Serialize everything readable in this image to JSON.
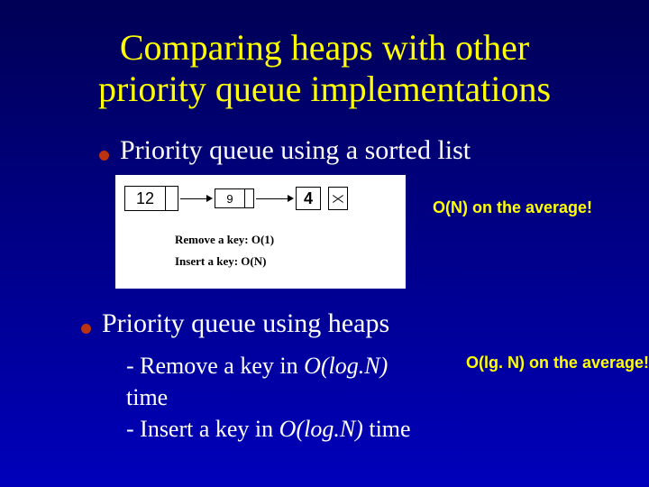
{
  "title_line1": "Comparing heaps with other",
  "title_line2": "priority queue implementations",
  "bullet1": "Priority queue using a sorted list",
  "bullet2": "Priority queue using heaps",
  "list_diagram": {
    "nodes": [
      "12",
      "9",
      "4"
    ],
    "remove_line": "Remove a key: O(1)",
    "insert_line": "Insert a key: O(N)"
  },
  "sidenote1": "O(N) on the average!",
  "heap_remove_prefix": "- Remove a key in ",
  "heap_remove_bigO": "O(log.N)",
  "heap_remove_suffix": " time",
  "heap_insert_prefix": "- Insert a key in ",
  "heap_insert_bigO": "O(log.N)",
  "heap_insert_suffix": " time",
  "sidenote2": "O(lg. N) on the average!"
}
